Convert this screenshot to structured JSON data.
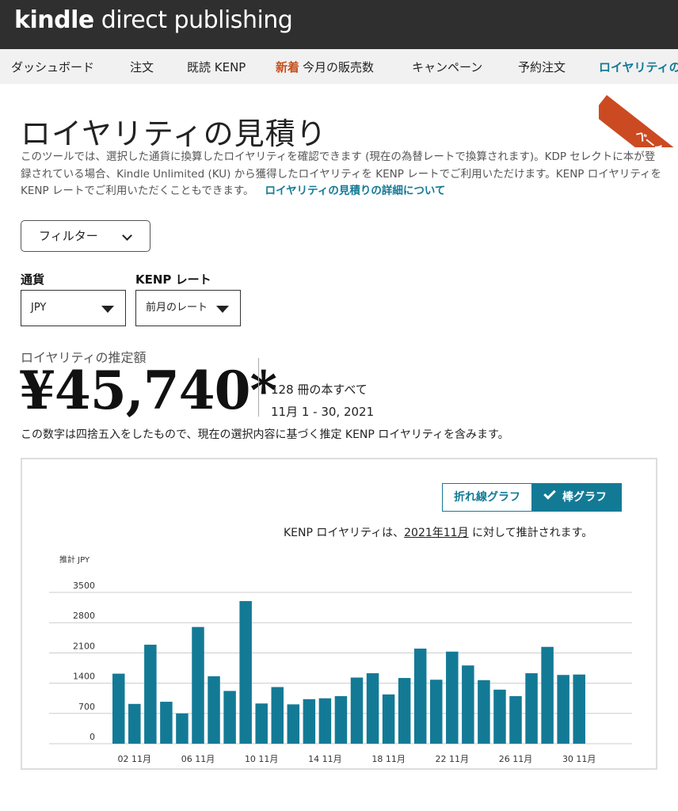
{
  "header": {
    "logo_brand": "kindle",
    "logo_rest": " direct publishing"
  },
  "nav": {
    "items": [
      {
        "label": "ダッシュボード"
      },
      {
        "label": "注文"
      },
      {
        "label": "既読 KENP"
      },
      {
        "badge": "新着",
        "label": "今月の販売数"
      },
      {
        "label": "キャンペーン"
      },
      {
        "label": "予約注文"
      },
      {
        "label": "ロイヤリティの"
      }
    ]
  },
  "beta": {
    "label": "ベータ"
  },
  "page": {
    "title": "ロイヤリティの見積り",
    "description": "このツールでは、選択した通貨に換算したロイヤリティを確認できます (現在の為替レートで換算されます)。KDP セレクトに本が登録されている場合、Kindle Unlimited (KU) から獲得したロイヤリティを KENP レートでご利用いただけます。KENP ロイヤリティを KENP レートでご利用いただくこともできます。",
    "details_link": "ロイヤリティの見積りの詳細について"
  },
  "filter": {
    "label": "フィルター"
  },
  "currency": {
    "label": "通貨",
    "value": "JPY"
  },
  "kenp_rate": {
    "label": "KENP レート",
    "value": "前月のレート"
  },
  "estimate": {
    "label": "ロイヤリティの推定額",
    "amount": "¥45,740*",
    "books": "128 冊の本すべて",
    "period": "11月 1 - 30, 2021",
    "note": "この数字は四捨五入をしたもので、現在の選択内容に基づく推定 KENP ロイヤリティを含みます。"
  },
  "chart_toggle": {
    "line_label": "折れ線グラフ",
    "bar_label": "棒グラフ",
    "selected": "bar"
  },
  "kenp_note": {
    "prefix": "KENP ロイヤリティは、",
    "month": "2021年11月",
    "suffix": " に対して推計されます。"
  },
  "colors": {
    "bar": "#137a96",
    "accent": "#137a96",
    "beta": "#cc4a21",
    "new_badge": "#c7511f"
  },
  "chart_data": {
    "type": "bar",
    "ylabel": "推計 JPY",
    "yticks": [
      0,
      700,
      1400,
      2100,
      2800,
      3500
    ],
    "ylim": [
      0,
      3500
    ],
    "grid": true,
    "categories": [
      "01 11月",
      "02 11月",
      "03 11月",
      "04 11月",
      "05 11月",
      "06 11月",
      "07 11月",
      "08 11月",
      "09 11月",
      "10 11月",
      "11 11月",
      "12 11月",
      "13 11月",
      "14 11月",
      "15 11月",
      "16 11月",
      "17 11月",
      "18 11月",
      "19 11月",
      "20 11月",
      "21 11月",
      "22 11月",
      "23 11月",
      "24 11月",
      "25 11月",
      "26 11月",
      "27 11月",
      "28 11月",
      "29 11月",
      "30 11月"
    ],
    "xtick_labels": [
      "02 11月",
      "06 11月",
      "10 11月",
      "14 11月",
      "18 11月",
      "22 11月",
      "26 11月",
      "30 11月"
    ],
    "values": [
      1620,
      920,
      2290,
      970,
      700,
      2700,
      1560,
      1220,
      3300,
      930,
      1310,
      910,
      1030,
      1050,
      1100,
      1530,
      1630,
      1140,
      1520,
      2200,
      1480,
      2130,
      1810,
      1470,
      1250,
      1100,
      1630,
      2240,
      1590,
      1600
    ]
  }
}
